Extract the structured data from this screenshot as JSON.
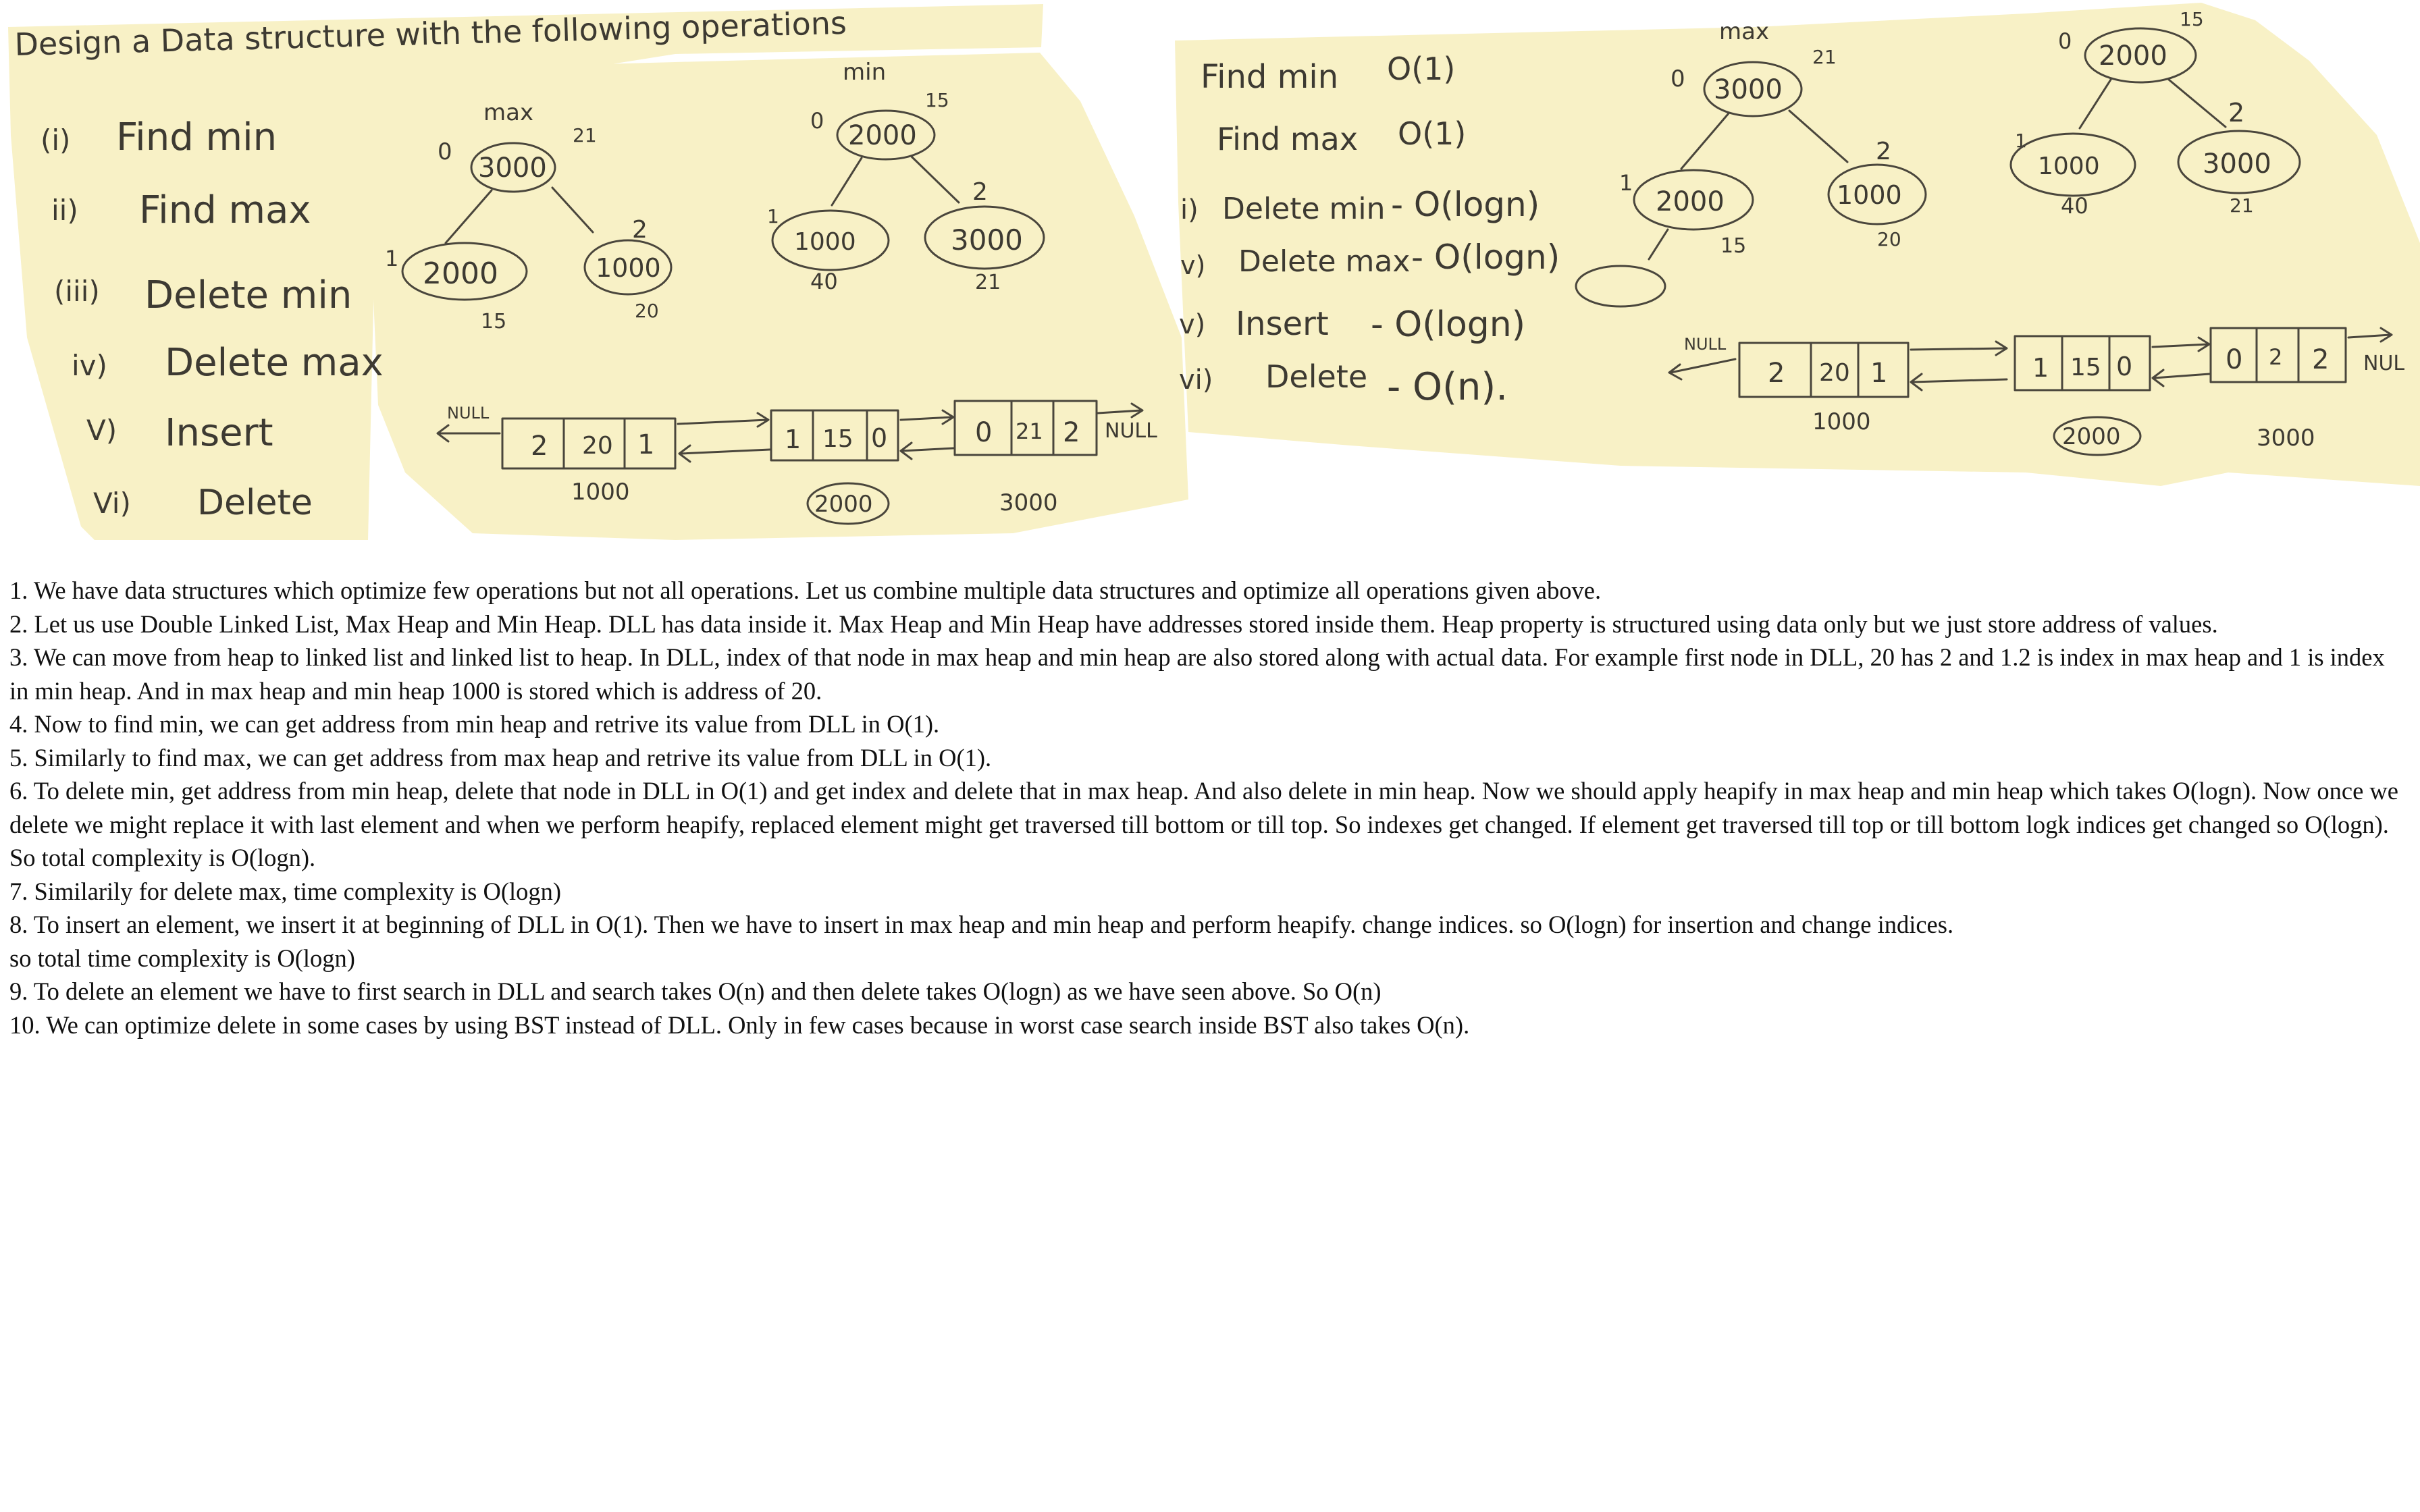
{
  "whiteboard_left": {
    "heading": "Design a Data structure with the following operations",
    "operations": [
      {
        "num": "(i)",
        "label": "Find min"
      },
      {
        "num": "ii)",
        "label": "Find max"
      },
      {
        "num": "(iii)",
        "label": "Delete min"
      },
      {
        "num": "iv)",
        "label": "Delete max"
      },
      {
        "num": "V)",
        "label": "Insert"
      },
      {
        "num": "Vi)",
        "label": "Delete"
      }
    ],
    "max_heap": {
      "title": "max",
      "root": {
        "addr": "3000",
        "value": "21",
        "index": "0"
      },
      "left": {
        "addr": "2000",
        "value": "15",
        "index": "1"
      },
      "right": {
        "addr": "1000",
        "value": "20",
        "index": "2"
      }
    },
    "min_heap": {
      "title": "min",
      "root": {
        "addr": "2000",
        "value": "15",
        "index": "0"
      },
      "left": {
        "addr": "1000",
        "value": "40",
        "index": "1"
      },
      "right": {
        "addr": "3000",
        "value": "21",
        "index": "2"
      }
    },
    "dll": {
      "null_left": "NULL",
      "null_right": "NULL",
      "nodes": [
        {
          "cells": [
            "2",
            "20",
            "1"
          ],
          "addr": "1000"
        },
        {
          "cells": [
            "1",
            "15",
            "0"
          ],
          "addr": "2000"
        },
        {
          "cells": [
            "0",
            "21",
            "2"
          ],
          "addr": "3000"
        }
      ]
    }
  },
  "whiteboard_right": {
    "complexities": [
      {
        "num": "",
        "op": "Find min",
        "cost": "O(1)"
      },
      {
        "num": "",
        "op": "Find max",
        "cost": "O(1)"
      },
      {
        "num": "i)",
        "op": "Delete min",
        "cost": "- O(logn)"
      },
      {
        "num": "v)",
        "op": "Delete max",
        "cost": "- O(logn)"
      },
      {
        "num": "v)",
        "op": "Insert",
        "cost": "- O(logn)"
      },
      {
        "num": "vi)",
        "op": "Delete",
        "cost": "- O(n)."
      }
    ],
    "max_heap": {
      "title": "max",
      "root": {
        "addr": "3000",
        "value": "21",
        "index": "0"
      },
      "left": {
        "addr": "2000",
        "value": "15",
        "index": "1"
      },
      "right": {
        "addr": "1000",
        "value": "20",
        "index": "2"
      }
    },
    "min_heap": {
      "root": {
        "addr": "2000",
        "value": "15",
        "index": "0"
      },
      "left": {
        "addr": "1000",
        "value": "40",
        "index": "1"
      },
      "right": {
        "addr": "3000",
        "value": "21",
        "index": "2"
      }
    },
    "dll": {
      "null_left": "NULL",
      "null_right": "NUL",
      "nodes": [
        {
          "cells": [
            "2",
            "20",
            "1"
          ],
          "addr": "1000"
        },
        {
          "cells": [
            "1",
            "15",
            "0"
          ],
          "addr": "2000"
        },
        {
          "cells": [
            "0",
            "2",
            "2"
          ],
          "addr": "3000"
        }
      ]
    }
  },
  "notes": [
    "1. We have data structures which optimize few operations but not all operations. Let us combine multiple data structures and optimize all operations given above.",
    "2. Let us use Double Linked List, Max Heap and Min Heap. DLL has data inside it. Max Heap and Min Heap have addresses stored inside them. Heap property is structured using data only but we just store address of values.",
    "3. We can move from heap to linked list and linked list to heap. In DLL, index of that node in max heap and min heap are also stored along with actual data. For example first node in DLL, 20 has 2 and 1.2 is index in max heap and 1 is index in min heap. And in max heap and min heap 1000 is stored which is address of 20.",
    "4. Now to find min, we can get address from min heap and retrive its value from DLL in O(1).",
    "5. Similarly to find max, we can get address from max heap and retrive its value from DLL in O(1).",
    "6. To delete min, get address from min heap, delete that node in DLL in O(1) and get index and delete that in max heap. And also delete in min heap. Now we should apply heapify in max heap and min heap which takes O(logn). Now once we delete we might replace it with last element and when we perform heapify, replaced element might get traversed till bottom or till top. So indexes get changed. If element get traversed till top or till bottom logk indices get changed so O(logn). So total complexity is O(logn).",
    "7. Similarily for delete max, time complexity is O(logn)",
    "8. To insert an element, we insert it at beginning of DLL in O(1). Then we have to insert in max heap and min heap and perform heapify. change indices. so O(logn) for insertion and change indices.",
    "so total time complexity is O(logn)",
    "9. To delete an element we have to first search in DLL and search takes O(n) and then delete takes O(logn) as we have seen above. So O(n)",
    "10. We can optimize delete in some cases by using BST instead of DLL. Only in few cases because in worst case search inside BST also takes O(n)."
  ],
  "colors": {
    "paper": "#f9f2c8",
    "ink": "#3d3a32",
    "text": "#111111"
  }
}
